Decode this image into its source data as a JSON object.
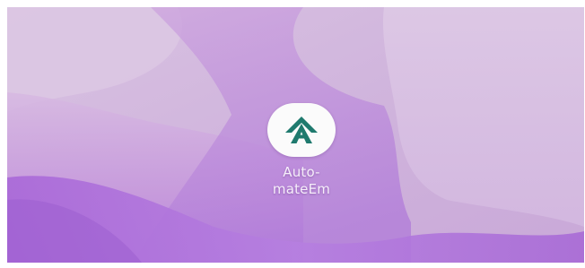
{
  "home_screen": {
    "wallpaper": {
      "colors": {
        "base": "#c8a6d6",
        "light": "#e2cfe8",
        "mid": "#c49ad8",
        "deep": "#a870d8",
        "accent": "#b27ee2"
      }
    },
    "app_shortcut": {
      "label": "Auto-\nmateEm",
      "icon": "automateem-logo-icon",
      "icon_color": "#1f7a6e",
      "icon_background": "#fbfbfb"
    }
  }
}
